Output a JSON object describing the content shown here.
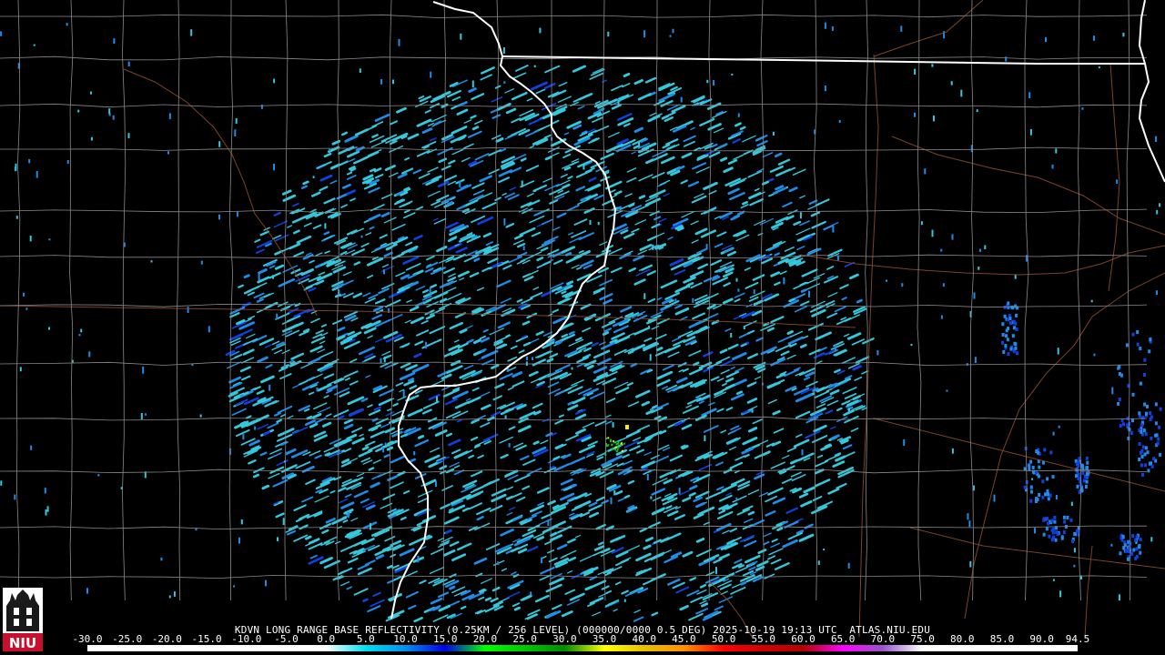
{
  "caption": "KDVN LONG RANGE BASE REFLECTIVITY (0.25KM / 256 LEVEL) (000000/0000 0.5 DEG) 2025-10-19 19:13 UTC  ATLAS.NIU.EDU",
  "logo_text": "NIU",
  "colorbar": {
    "ticks": [
      "-30.0",
      "-25.0",
      "-20.0",
      "-15.0",
      "-10.0",
      "-5.0",
      "0.0",
      "5.0",
      "10.0",
      "15.0",
      "20.0",
      "25.0",
      "30.0",
      "35.0",
      "40.0",
      "45.0",
      "50.0",
      "55.0",
      "60.0",
      "65.0",
      "70.0",
      "75.0",
      "80.0",
      "85.0",
      "90.0",
      "94.5"
    ],
    "range": [
      -30.0,
      94.5
    ],
    "colors": [
      {
        "value": -30,
        "color": "#ffffff"
      },
      {
        "value": 0,
        "color": "#ffffff"
      },
      {
        "value": 5,
        "color": "#00e0f0"
      },
      {
        "value": 10,
        "color": "#0090f0"
      },
      {
        "value": 15,
        "color": "#0000e8"
      },
      {
        "value": 20,
        "color": "#00ff00"
      },
      {
        "value": 25,
        "color": "#00c800"
      },
      {
        "value": 30,
        "color": "#008c00"
      },
      {
        "value": 35,
        "color": "#ffff00"
      },
      {
        "value": 40,
        "color": "#e8c000"
      },
      {
        "value": 45,
        "color": "#ff9000"
      },
      {
        "value": 50,
        "color": "#ff0000"
      },
      {
        "value": 55,
        "color": "#d00000"
      },
      {
        "value": 60,
        "color": "#b80000"
      },
      {
        "value": 65,
        "color": "#ff00ff"
      },
      {
        "value": 70,
        "color": "#9955c9"
      },
      {
        "value": 75,
        "color": "#ffffff"
      },
      {
        "value": 94.5,
        "color": "#ffffff"
      }
    ]
  },
  "colors": {
    "background": "#000000",
    "county_lines": "#8a8a8a",
    "state_lines": "#ffffff",
    "roads": "#8b4a2b",
    "echo_light": "#34c8dc",
    "echo_mid": "#1e8ce8",
    "echo_dark": "#1040e0",
    "echo_green": "#18c018",
    "echo_yellow": "#f0f000",
    "logo_red": "#c8102e"
  },
  "icons": {
    "logo": "niu-tower-logo"
  }
}
